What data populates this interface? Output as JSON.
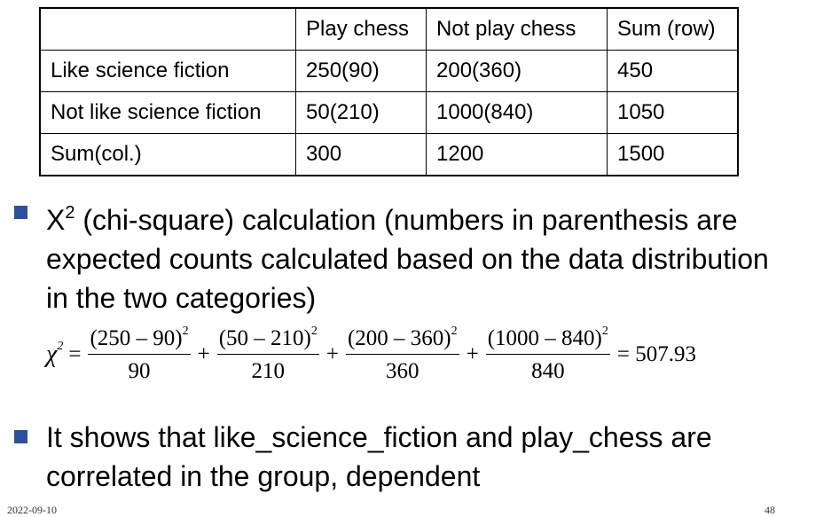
{
  "table": {
    "header": [
      "",
      "Play chess",
      "Not play chess",
      "Sum (row)"
    ],
    "rows": [
      [
        "Like science fiction",
        "250(90)",
        "200(360)",
        "450"
      ],
      [
        "Not like science fiction",
        "50(210)",
        "1000(840)",
        "1050"
      ],
      [
        "Sum(col.)",
        "300",
        "1200",
        "1500"
      ]
    ]
  },
  "bullet1": {
    "lead": "X",
    "superscript": "2",
    "lines": [
      " (chi-square) calculation (numbers in parenthesis are",
      "expected counts calculated based on the data distribution",
      "in the two categories)"
    ]
  },
  "formula": {
    "symbol": "χ",
    "symbol_sup": "2",
    "equals": "=",
    "plus": "+",
    "terms": [
      {
        "num": "(250 – 90)",
        "sup": "2",
        "den": "90"
      },
      {
        "num": "(50 – 210)",
        "sup": "2",
        "den": "210"
      },
      {
        "num": "(200 – 360)",
        "sup": "2",
        "den": "360"
      },
      {
        "num": "(1000 – 840)",
        "sup": "2",
        "den": "840"
      }
    ],
    "result": "= 507.93"
  },
  "bullet2": {
    "lines": [
      "It shows that like_science_fiction and play_chess are",
      "correlated in the group, dependent"
    ]
  },
  "footer": {
    "date": "2022-09-10",
    "page": "48"
  },
  "colors": {
    "bullet": "#2f4f9c"
  }
}
